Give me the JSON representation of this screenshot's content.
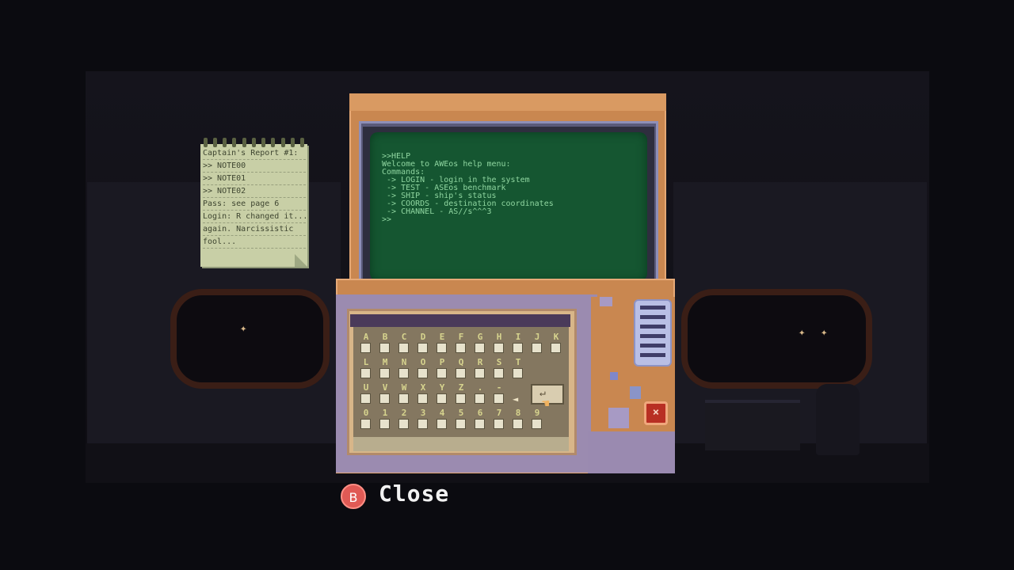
{
  "note": {
    "lines": [
      "Captain's Report #1:",
      ">> NOTE00",
      ">> NOTE01",
      ">> NOTE02",
      "Pass: see page 6",
      "Login: R changed it...",
      "again. Narcissistic",
      "fool..."
    ]
  },
  "terminal": {
    "lines": [
      ">>HELP",
      "Welcome to AWEos help menu:",
      "Commands:",
      " -> LOGIN - login in the system",
      " -> TEST - ASEos benchmark",
      " -> SHIP - ship's status",
      " -> COORDS - destination coordinates",
      " -> CHANNEL - AS//s^^^3",
      ">>"
    ]
  },
  "keyboard": {
    "rows": [
      [
        "A",
        "B",
        "C",
        "D",
        "E",
        "F",
        "G",
        "H",
        "I",
        "J",
        "K"
      ],
      [
        "L",
        "M",
        "N",
        "O",
        "P",
        "Q",
        "R",
        "S",
        "T"
      ],
      [
        "U",
        "V",
        "W",
        "X",
        "Y",
        "Z",
        ".",
        "-"
      ],
      [
        "0",
        "1",
        "2",
        "3",
        "4",
        "5",
        "6",
        "7",
        "8",
        "9"
      ]
    ],
    "backspace_label": "◄",
    "enter_label": "↵"
  },
  "controls": {
    "close_icon": "×"
  },
  "prompt": {
    "button": "B",
    "label": "Close"
  },
  "colors": {
    "screen": "#155631",
    "terminal_text": "#8fd6a0",
    "casing": "#c98750",
    "close_button": "#b82f23"
  }
}
